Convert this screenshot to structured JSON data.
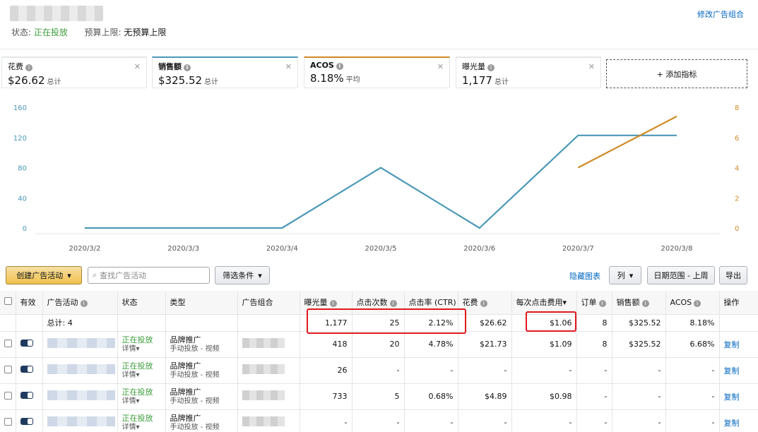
{
  "header": {
    "status_label": "状态:",
    "status_value": "正在投放",
    "budget_label": "预算上限:",
    "budget_value": "无预算上限",
    "edit_link": "修改广告组合"
  },
  "cards": [
    {
      "label": "花费",
      "value": "$26.62",
      "suffix": "总计",
      "color": "#ffffff"
    },
    {
      "label": "销售额",
      "value": "$325.52",
      "suffix": "总计",
      "color": "#4a98b7"
    },
    {
      "label": "ACOS",
      "value": "8.18%",
      "suffix": "平均",
      "color": "#d08a22"
    },
    {
      "label": "曝光量",
      "value": "1,177",
      "suffix": "总计",
      "color": "#ffffff"
    }
  ],
  "add_metric": "+ 添加指标",
  "chart_data": {
    "type": "line",
    "x": [
      "2020/3/2",
      "2020/3/3",
      "2020/3/4",
      "2020/3/5",
      "2020/3/6",
      "2020/3/7",
      "2020/3/8"
    ],
    "left_axis": {
      "ticks": [
        0,
        40,
        80,
        120,
        160
      ],
      "range": [
        0,
        160
      ]
    },
    "right_axis": {
      "ticks": [
        0,
        2,
        4,
        6,
        8
      ],
      "range": [
        0,
        8
      ]
    },
    "series": [
      {
        "axis": "left",
        "color": "#4a98b7",
        "values": [
          0,
          0,
          0,
          80,
          0,
          122.8,
          122.8
        ]
      },
      {
        "axis": "right",
        "color": "#d08a22",
        "values": [
          null,
          null,
          null,
          null,
          null,
          4.0,
          7.4
        ]
      }
    ],
    "grid": false
  },
  "toolbar": {
    "create_label": "创建广告活动",
    "search_placeholder": "查找广告活动",
    "filter_label": "筛选条件",
    "hide_chart": "隐藏图表",
    "columns_label": "列",
    "date_range": "日期范围 - 上周",
    "export": "导出"
  },
  "table": {
    "headers": [
      "有效",
      "广告活动",
      "状态",
      "类型",
      "广告组合",
      "曝光量",
      "点击次数",
      "点击率 (CTR)",
      "花费",
      "每次点击费用",
      "订单",
      "销售额",
      "ACOS",
      "操作"
    ],
    "total": {
      "label": "总计: 4",
      "impressions": "1,177",
      "clicks": "25",
      "ctr": "2.12%",
      "spend": "$26.62",
      "cpc": "$1.06",
      "orders": "8",
      "sales": "$325.52",
      "acos": "8.18%"
    },
    "rows": [
      {
        "status": "正在投放",
        "details": "详情",
        "type": "品牌推广",
        "subtype": "手动投放 - 视频",
        "impressions": "418",
        "clicks": "20",
        "ctr": "4.78%",
        "spend": "$21.73",
        "cpc": "$1.09",
        "orders": "8",
        "sales": "$325.52",
        "acos": "6.68%",
        "action": "复制"
      },
      {
        "status": "正在投放",
        "details": "详情",
        "type": "品牌推广",
        "subtype": "手动投放 - 视频",
        "impressions": "26",
        "clicks": "-",
        "ctr": "-",
        "spend": "-",
        "cpc": "-",
        "orders": "-",
        "sales": "-",
        "acos": "-",
        "action": "复制"
      },
      {
        "status": "正在投放",
        "details": "详情",
        "type": "品牌推广",
        "subtype": "手动投放 - 视频",
        "impressions": "733",
        "clicks": "5",
        "ctr": "0.68%",
        "spend": "$4.89",
        "cpc": "$0.98",
        "orders": "-",
        "sales": "-",
        "acos": "-",
        "action": "复制"
      },
      {
        "status": "正在投放",
        "details": "详情",
        "type": "品牌推广",
        "subtype": "手动投放 - 视频",
        "impressions": "-",
        "clicks": "-",
        "ctr": "-",
        "spend": "-",
        "cpc": "-",
        "orders": "-",
        "sales": "-",
        "acos": "-",
        "action": "复制"
      }
    ]
  }
}
